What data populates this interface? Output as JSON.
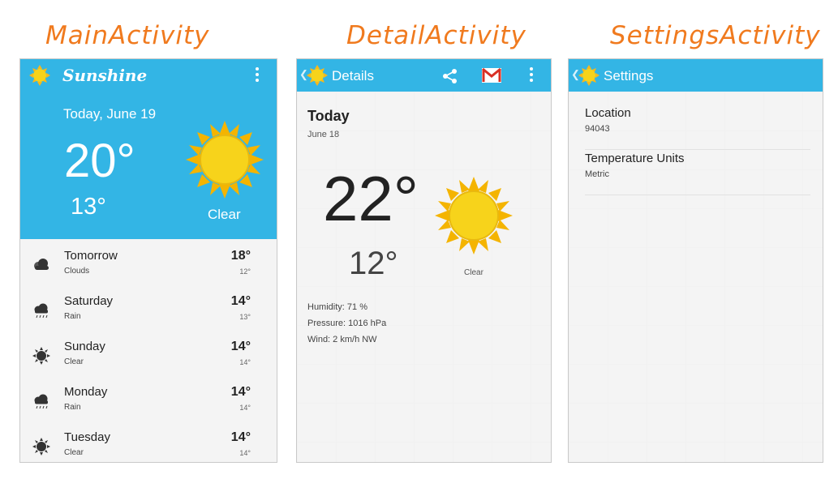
{
  "labels": {
    "main": "MainActivity",
    "detail": "DetailActivity",
    "settings": "SettingsActivity"
  },
  "colors": {
    "action_bar": "#33b5e5",
    "label": "#f07a1e",
    "sun": "#f7d31b"
  },
  "main": {
    "app_title": "Sunshine",
    "today": {
      "date": "Today, June 19",
      "high": "20°",
      "low": "13°",
      "condition": "Clear",
      "icon": "sun-icon"
    },
    "forecast": [
      {
        "day": "Tomorrow",
        "condition": "Clouds",
        "high": "18°",
        "low": "12°",
        "icon": "cloud-icon"
      },
      {
        "day": "Saturday",
        "condition": "Rain",
        "high": "14°",
        "low": "13°",
        "icon": "rain-icon"
      },
      {
        "day": "Sunday",
        "condition": "Clear",
        "high": "14°",
        "low": "14°",
        "icon": "sun-icon"
      },
      {
        "day": "Monday",
        "condition": "Rain",
        "high": "14°",
        "low": "14°",
        "icon": "rain-icon"
      },
      {
        "day": "Tuesday",
        "condition": "Clear",
        "high": "14°",
        "low": "14°",
        "icon": "sun-icon"
      }
    ]
  },
  "detail": {
    "title": "Details",
    "day": "Today",
    "date": "June 18",
    "high": "22°",
    "low": "12°",
    "condition": "Clear",
    "humidity": "Humidity: 71 %",
    "pressure": "Pressure: 1016 hPa",
    "wind": "Wind: 2 km/h NW"
  },
  "settings": {
    "title": "Settings",
    "prefs": [
      {
        "title": "Location",
        "value": "94043"
      },
      {
        "title": "Temperature Units",
        "value": "Metric"
      }
    ]
  }
}
